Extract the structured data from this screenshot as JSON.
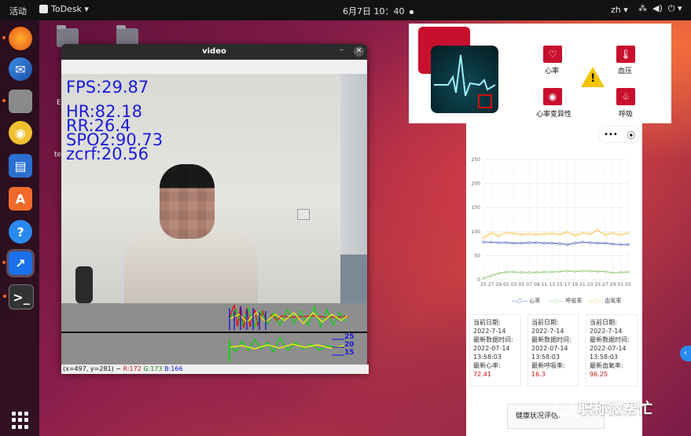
{
  "topbar": {
    "activities": "活动",
    "app_name": "ToDesk ▾",
    "clock": "6月7日 10：40",
    "lang": "zh ▾",
    "tray": [
      "⁂",
      "◀)",
      "⏻ ▾"
    ]
  },
  "dock": {
    "items": [
      "firefox-icon",
      "thunderbird-icon",
      "files-icon",
      "rhythmbox-icon",
      "writer-icon",
      "software-icon",
      "help-icon",
      "todesk-icon",
      "terminal-icon"
    ]
  },
  "desktop": {
    "labels": [
      "E",
      "te"
    ]
  },
  "video_window": {
    "title": "video",
    "min": "–",
    "close": "✕",
    "overlay": {
      "fps": "FPS:29.87",
      "hr": "HR:82.18",
      "rr": "RR:26.4",
      "spo2": "SPO2:90.73",
      "zcrf": "zcrf:20.56"
    },
    "ticks": [
      "25",
      "20",
      "15"
    ],
    "status": {
      "coords": "(x=497, y=281) ~ ",
      "r": "R:172",
      "g": "G:173",
      "b": "B:166"
    }
  },
  "health_panel": {
    "items": [
      {
        "icon": "heart-icon",
        "label": "心率"
      },
      {
        "icon": "thermometer-icon",
        "label": "血压"
      },
      {
        "icon": "hrv-icon",
        "label": "心率变异性"
      },
      {
        "icon": "lungs-icon",
        "label": "呼吸"
      }
    ]
  },
  "phone": {
    "ctl": [
      "•••",
      "⦿"
    ],
    "chart_data": {
      "type": "line",
      "categories": [
        "25",
        "27",
        "29",
        "01",
        "03",
        "05",
        "07",
        "09",
        "11",
        "13",
        "15",
        "17",
        "19",
        "21",
        "23",
        "25",
        "27",
        "29",
        "01",
        "03"
      ],
      "ylim": [
        0,
        250
      ],
      "yticks": [
        "250",
        "200",
        "150",
        "100",
        "50",
        "0"
      ],
      "series": [
        {
          "name": "心率",
          "color": "#5470c6",
          "values": [
            78,
            78,
            77,
            77,
            76,
            76,
            77,
            77,
            76,
            76,
            75,
            73,
            76,
            78,
            77,
            76,
            76,
            74,
            73,
            73
          ]
        },
        {
          "name": "呼吸率",
          "color": "#91cc75",
          "values": [
            3,
            8,
            13,
            16,
            16,
            15,
            15,
            15,
            16,
            16,
            17,
            18,
            17,
            18,
            18,
            17,
            17,
            14,
            15,
            16
          ]
        },
        {
          "name": "血氧率",
          "color": "#fac858",
          "values": [
            87,
            97,
            91,
            98,
            96,
            94,
            95,
            94,
            95,
            96,
            94,
            99,
            92,
            97,
            95,
            103,
            93,
            97,
            93,
            97
          ]
        }
      ],
      "grid": true,
      "legend": "bottom"
    },
    "cards": [
      {
        "l1": "当前日期:",
        "l2": "2022-7-14",
        "l3": "最新数据时间:",
        "l4": "2022-07-14",
        "l5": "13:58:03",
        "l6": "最新心率:",
        "v": "72.41"
      },
      {
        "l1": "当前日期:",
        "l2": "2022-7-14",
        "l3": "最新数据时间:",
        "l4": "2022-07-14",
        "l5": "13:58:03",
        "l6": "最新呼吸率:",
        "v": "16.3"
      },
      {
        "l1": "当前日期:",
        "l2": "2022-7-14",
        "l3": "最新数据时间:",
        "l4": "2022-07-14",
        "l5": "13:58:03",
        "l6": "最新血氧率:",
        "v": "96.25"
      }
    ],
    "eval_label": "健康状况评估:"
  },
  "watermark": "职称微帮忙",
  "side_button": "‹"
}
